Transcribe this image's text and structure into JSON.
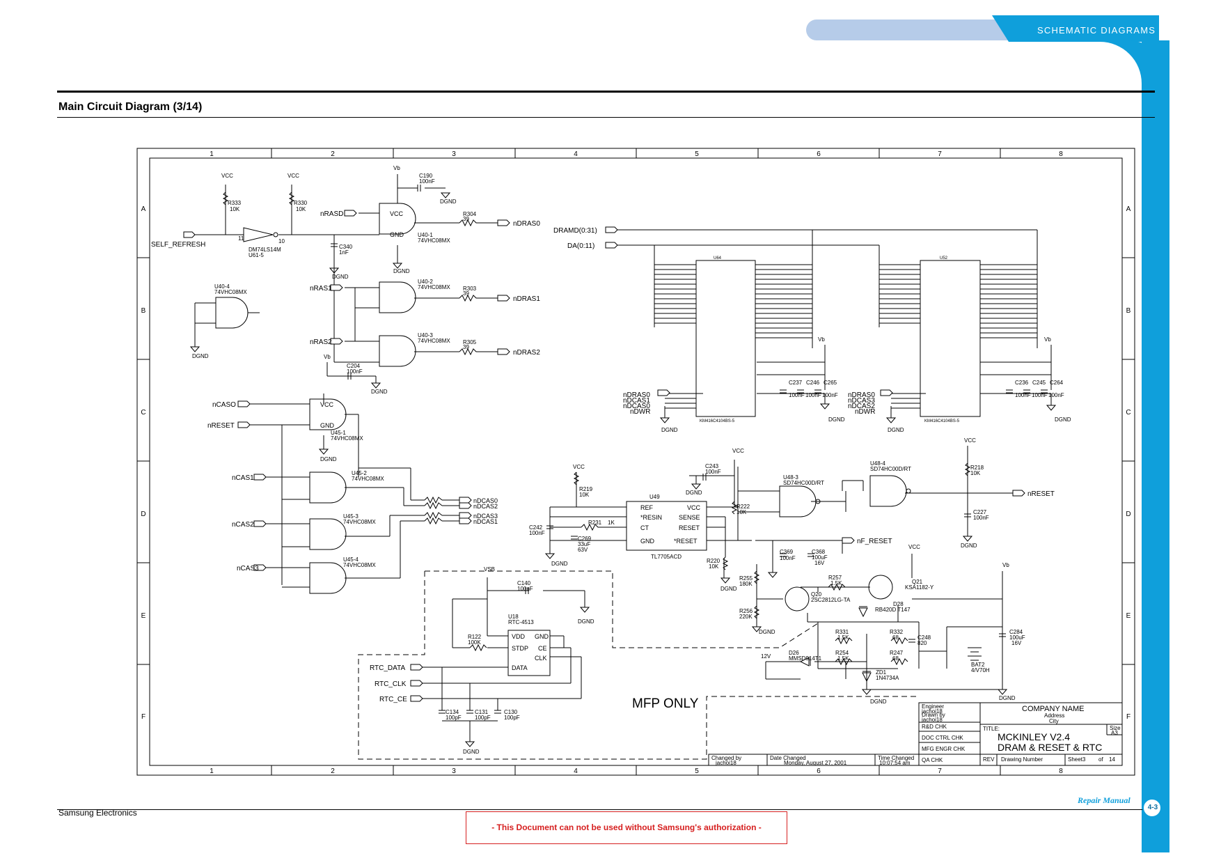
{
  "header": {
    "section_label": "SCHEMATIC DIAGRAMS"
  },
  "page_title": "Main Circuit Diagram (3/14)",
  "footer": {
    "company": "Samsung Electronics",
    "manual": "Repair Manual",
    "page": "4-3",
    "notice": "- This Document can not be used without Samsung's authorization -"
  },
  "grid": {
    "cols": [
      "1",
      "2",
      "3",
      "4",
      "5",
      "6",
      "7",
      "8"
    ],
    "rows": [
      "A",
      "B",
      "C",
      "D",
      "E",
      "F"
    ]
  },
  "colors": {
    "accent": "#0f9fdb",
    "pill": "#b6cce9",
    "notice": "#d62020"
  },
  "labels": {
    "vcc": "VCC",
    "vb": "Vb",
    "vsb": "VSB",
    "dgnd": "DGND",
    "v12": "12V",
    "r333": "R333",
    "r333v": "10K",
    "r330": "R330",
    "r330v": "10K",
    "self_refresh": "SELF_REFRESH",
    "u61": "DM74LS14M",
    "u61b": "U61-5",
    "pin11": "11",
    "pin10": "10",
    "c340": "C340",
    "c340v": "1nF",
    "c190": "C190",
    "c190v": "100nF",
    "nrasd": "nRASD",
    "u40_1": "U40-1",
    "u40_1p": "74VHC08MX",
    "r304": "R304",
    "r304v": "39",
    "ndras0": "nDRAS0",
    "u40_2": "U40-2",
    "u40_2p": "74VHC08MX",
    "nras1": "nRAS1",
    "r303": "R303",
    "r303v": "39",
    "ndras1": "nDRAS1",
    "u40_3": "U40-3",
    "u40_3p": "74VHC08MX",
    "nras2": "nRAS2",
    "r305": "R305",
    "r305v": "39",
    "ndras2": "nDRAS2",
    "u40_4": "U40-4",
    "u40_4p": "74VHC08MX",
    "c204": "C204",
    "c204v": "100nF",
    "ncaso": "nCASO",
    "nreset_in": "nRESET",
    "u45_1": "U45-1",
    "u45_1p": "74VHC08MX",
    "ncas1": "nCAS1",
    "u45_2": "U45-2",
    "u45_2p": "74VHC08MX",
    "ncas2": "nCAS2",
    "u45_3": "U45-3",
    "u45_3p": "74VHC08MX",
    "ncas3": "nCAS3",
    "u45_4": "U45-4",
    "u45_4p": "74VHC08MX",
    "ndcas0": "nDCAS0",
    "ndcas2": "nDCAS2",
    "ndcas3": "nDCAS3",
    "ndcas1": "nDCAS1",
    "dramd": "DRAMD(0:31)",
    "da": "DA(0:11)",
    "u64": "U64",
    "u52": "U52",
    "dram_part": "KM416C4104BS-5",
    "vcc_pin": "VCC",
    "gnd_pin": "GND",
    "c237": "C237",
    "c246": "C246",
    "c265": "C265",
    "c100nf": "100nF",
    "c236": "C236",
    "c245": "C245",
    "c264": "C264",
    "ndras0b": "nDRAS0",
    "ndcas1b": "nDCAS1",
    "ndcas0b": "nDCAS0",
    "ndwr": "nDWR",
    "ndras0c": "nDRAS0",
    "ndcas3b": "nDCAS3",
    "ndcas2b": "nDCAS2",
    "ndwrb": "nDWR",
    "c243": "C243",
    "c243v": "100nF",
    "r219": "R219",
    "r219v": "10K",
    "u49": "U49",
    "tl7705": "TL7705ACD",
    "ref": "REF",
    "resin": "*RESIN",
    "ct": "CT",
    "gnd": "GND",
    "sense": "SENSE",
    "reset": "RESET",
    "nreset_o": "*RESET",
    "c242": "C242",
    "c242v": "100nF",
    "r231": "R231",
    "r231v": "1K",
    "c269": "C269",
    "c269v": "33uF",
    "c269w": "63V",
    "r222": "R222",
    "r222v": "10K",
    "r220": "R220",
    "r220v": "10K",
    "u48_3": "U48-3",
    "u48_3p": "SD74HC00D/RT",
    "u48_4": "U48-4",
    "u48_4p": "SD74HC00D/RT",
    "r218": "R218",
    "r218v": "10K",
    "nreset_out": "nRESET",
    "c227": "C227",
    "c227v": "100nF",
    "nf_reset": "nF_RESET",
    "c369": "C369",
    "c369v": "100nF",
    "c368": "C368",
    "c368v": "100uF",
    "c368w": "16V",
    "r255": "R255",
    "r255v": "180K",
    "r256": "R256",
    "r256v": "220K",
    "r257": "R257",
    "r257v": "1.5K",
    "q20": "Q20",
    "q20p": "2SC2812LG-TA",
    "q21": "Q21",
    "q21p": "KSA1182-Y",
    "d28": "D28",
    "d28p": "RB420D T147",
    "c140": "C140",
    "c140v": "100nF",
    "u18": "U18",
    "u18p": "RTC-4513",
    "r122": "R122",
    "r122v": "100K",
    "vdd": "VDD",
    "stdp": "STDP",
    "data": "DATA",
    "ce": "CE",
    "clk": "CLK",
    "rtc_data": "RTC_DATA",
    "rtc_clk": "RTC_CLK",
    "rtc_ce": "RTC_CE",
    "c134": "C134",
    "c131": "C131",
    "c130": "C130",
    "c100pf": "100pF",
    "r331": "R331",
    "r331v": "1.5K",
    "r254": "R254",
    "r254v": "1.5K",
    "r332": "R332",
    "r332v": "68",
    "r247": "R247",
    "r247v": "68",
    "c248": "C248",
    "c248v": "820",
    "d26": "D26",
    "d26p": "MMSD914T1",
    "zd1": "ZD1",
    "zd1p": "1N4734A",
    "bat2": "BAT2",
    "bat2v": "4/V70H",
    "c284": "C284",
    "c284v": "100uF",
    "c284w": "16V",
    "mfp": "MFP ONLY"
  },
  "title_block": {
    "engineer": "Engineer",
    "engineer_name": "jachoi18",
    "drawn": "Drawn by",
    "drawn_name": "jachoi18",
    "rd_chk": "R&D CHK",
    "doc_ctrl": "DOC CTRL CHK",
    "mfg_engr": "MFG ENGR CHK",
    "qa_chk": "QA CHK",
    "company": "COMPANY NAME",
    "address": "Address",
    "city": "City",
    "title_label": "TITLE:",
    "title_line1": "MCKINLEY V2.4",
    "title_line2": "DRAM & RESET & RTC",
    "size_label": "Size",
    "size": "A3",
    "rev": "REV",
    "drawing_number": "Drawing Number",
    "sheet": "Sheet3",
    "of": "of",
    "sheets": "14",
    "changed_by": "Changed by",
    "changed_by_name": "jachoi18",
    "date_changed": "Date Changed",
    "date": "Monday, August 27, 2001",
    "time_changed": "Time Changed",
    "time": "10:07:54 am"
  }
}
